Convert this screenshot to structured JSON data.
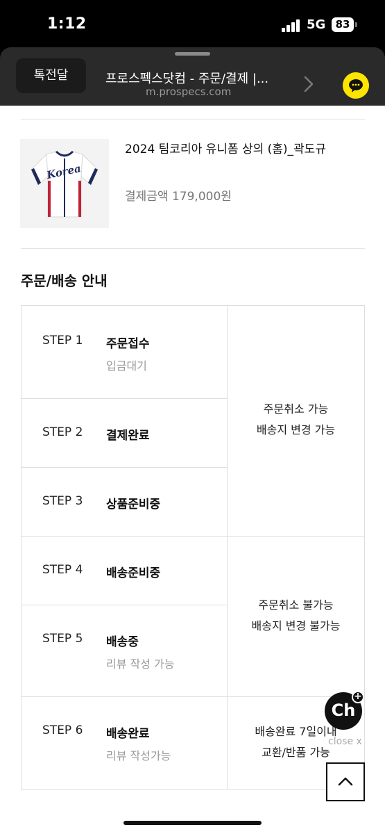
{
  "status_bar": {
    "time": "1:12",
    "network": "5G",
    "battery": "83"
  },
  "browser": {
    "tab_label": "톡전달",
    "title": "프로스펙스닷컴 - 주문/결제 |...",
    "url": "m.prospecs.com"
  },
  "product": {
    "name": "2024 팀코리아 유니폼 상의 (홈)_곽도규",
    "price": "결제금액 179,000원",
    "jersey_lettering": "Korea"
  },
  "guide": {
    "title": "주문/배송 안내",
    "steps": [
      {
        "label": "STEP 1",
        "name": "주문접수",
        "sub": "입금대기"
      },
      {
        "label": "STEP 2",
        "name": "결제완료",
        "sub": ""
      },
      {
        "label": "STEP 3",
        "name": "상품준비중",
        "sub": ""
      },
      {
        "label": "STEP 4",
        "name": "배송준비중",
        "sub": ""
      },
      {
        "label": "STEP 5",
        "name": "배송중",
        "sub": "리뷰 작성 가능"
      },
      {
        "label": "STEP 6",
        "name": "배송완료",
        "sub": "리뷰 작성가능"
      }
    ],
    "groups": [
      {
        "line1": "주문취소 가능",
        "line2": "배송지 변경 가능"
      },
      {
        "line1": "주문취소 불가능",
        "line2": "배송지 변경 불가능"
      },
      {
        "line1": "배송완료 7일이내",
        "line2": "교환/반품 가능"
      }
    ]
  },
  "floating": {
    "channel_label": "Ch",
    "channel_plus": "+",
    "close_label": "close x"
  },
  "colors": {
    "kakao_yellow": "#fee500",
    "text_muted": "#999999"
  }
}
